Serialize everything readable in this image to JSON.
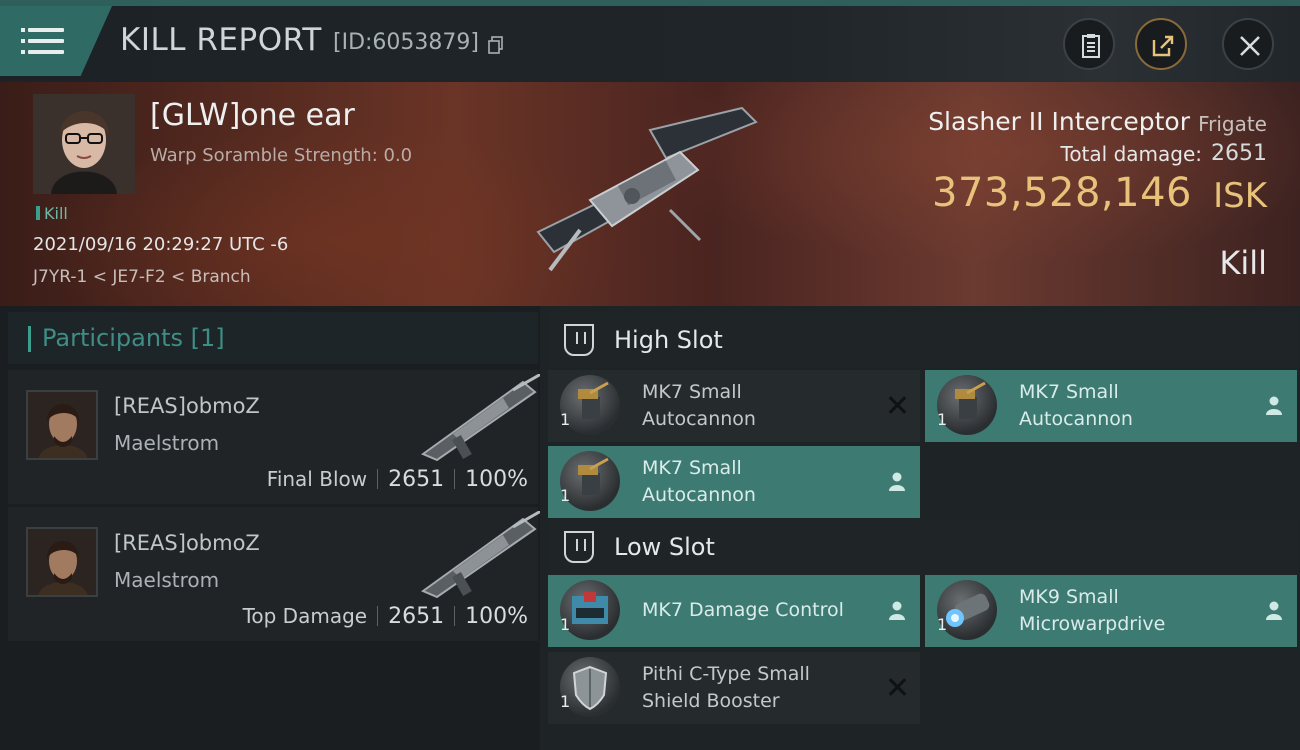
{
  "header": {
    "title": "KILL REPORT",
    "report_id": "[ID:6053879]",
    "icons": [
      "menu-icon",
      "copy-icon",
      "clipboard-icon",
      "share-icon",
      "close-icon"
    ]
  },
  "victim": {
    "name": "[GLW]one ear",
    "scramble_label": "Warp Soramble Strength: 0.0",
    "tag": "Kill",
    "date": "2021/09/16 20:29:27 UTC -6",
    "location": "J7YR-1 < JE7-F2 < Branch",
    "ship_name": "Slasher II Interceptor",
    "ship_class": "Frigate",
    "total_damage_label": "Total damage:",
    "total_damage_value": "2651",
    "isk_value": "373,528,146",
    "isk_unit": "ISK",
    "kill_type": "Kill"
  },
  "participants": {
    "title": "Participants",
    "count": "[1]",
    "items": [
      {
        "name": "[REAS]obmoZ",
        "ship": "Maelstrom",
        "role": "Final Blow",
        "damage": "2651",
        "percent": "100%"
      },
      {
        "name": "[REAS]obmoZ",
        "ship": "Maelstrom",
        "role": "Top Damage",
        "damage": "2651",
        "percent": "100%"
      }
    ]
  },
  "slots": {
    "high": {
      "title": "High Slot",
      "modules": [
        {
          "line1": "MK7 Small",
          "line2": "Autocannon",
          "qty": "1",
          "status": "destroyed"
        },
        {
          "line1": "MK7 Small",
          "line2": "Autocannon",
          "qty": "1",
          "status": "dropped"
        },
        {
          "line1": "MK7 Small",
          "line2": "Autocannon",
          "qty": "1",
          "status": "dropped"
        }
      ]
    },
    "low": {
      "title": "Low Slot",
      "modules": [
        {
          "line1": "MK7 Damage Control",
          "line2": "",
          "qty": "1",
          "status": "dropped"
        },
        {
          "line1": "MK9 Small",
          "line2": "Microwarpdrive",
          "qty": "1",
          "status": "dropped"
        },
        {
          "line1": "Pithi C-Type Small",
          "line2": "Shield Booster",
          "qty": "1",
          "status": "destroyed"
        }
      ]
    }
  },
  "colors": {
    "accent": "#3aa08d",
    "isk": "#e8c27a",
    "dropped": "#3d7a72",
    "destroyed": "#252a2d"
  }
}
